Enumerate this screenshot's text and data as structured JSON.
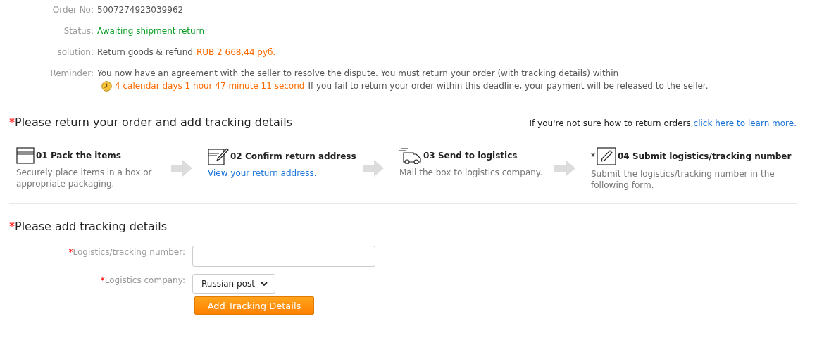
{
  "order_info": {
    "order_no": {
      "label": "Order No:",
      "value": "5007274923039962"
    },
    "status": {
      "label": "Status:",
      "value": "Awaiting shipment return"
    },
    "solution": {
      "label": "solution:",
      "value": "Return goods & refund",
      "amount": "RUB 2 668,44 руб."
    },
    "reminder": {
      "label": "Reminder:",
      "text": "You now have an agreement with the seller to resolve the dispute. You must return your order (with tracking details) within",
      "countdown": "4 calendar days 1 hour 47 minute 11 second",
      "text_after": "If you fail to return your order within this deadline, your payment will be released to the seller."
    }
  },
  "return_section": {
    "required_mark": "*",
    "title": "Please return your order and add tracking details",
    "help_text": "If you're not sure how to return orders,",
    "help_link": "click here to learn more."
  },
  "steps": [
    {
      "kind": "box",
      "title": "01 Pack the items",
      "description": "Securely place items in a box or appropriate packaging."
    },
    {
      "kind": "box-edit",
      "title": "02 Confirm return address",
      "link": "View your return address."
    },
    {
      "kind": "truck",
      "title": "03 Send to logistics",
      "description": "Mail the box to logistics company."
    },
    {
      "kind": "pencil",
      "marker": "*",
      "title": "04 Submit logistics/tracking number",
      "description": "Submit the logistics/tracking number in the following form."
    }
  ],
  "tracking_section": {
    "required_mark": "*",
    "title": "Please add tracking details"
  },
  "form": {
    "fields": [
      {
        "kind": "text",
        "required_mark": "*",
        "label": "Logistics/tracking number:"
      },
      {
        "kind": "select",
        "required_mark": "*",
        "label": "Logistics company:",
        "value": "Russian post"
      }
    ],
    "button": "Add Tracking Details"
  }
}
